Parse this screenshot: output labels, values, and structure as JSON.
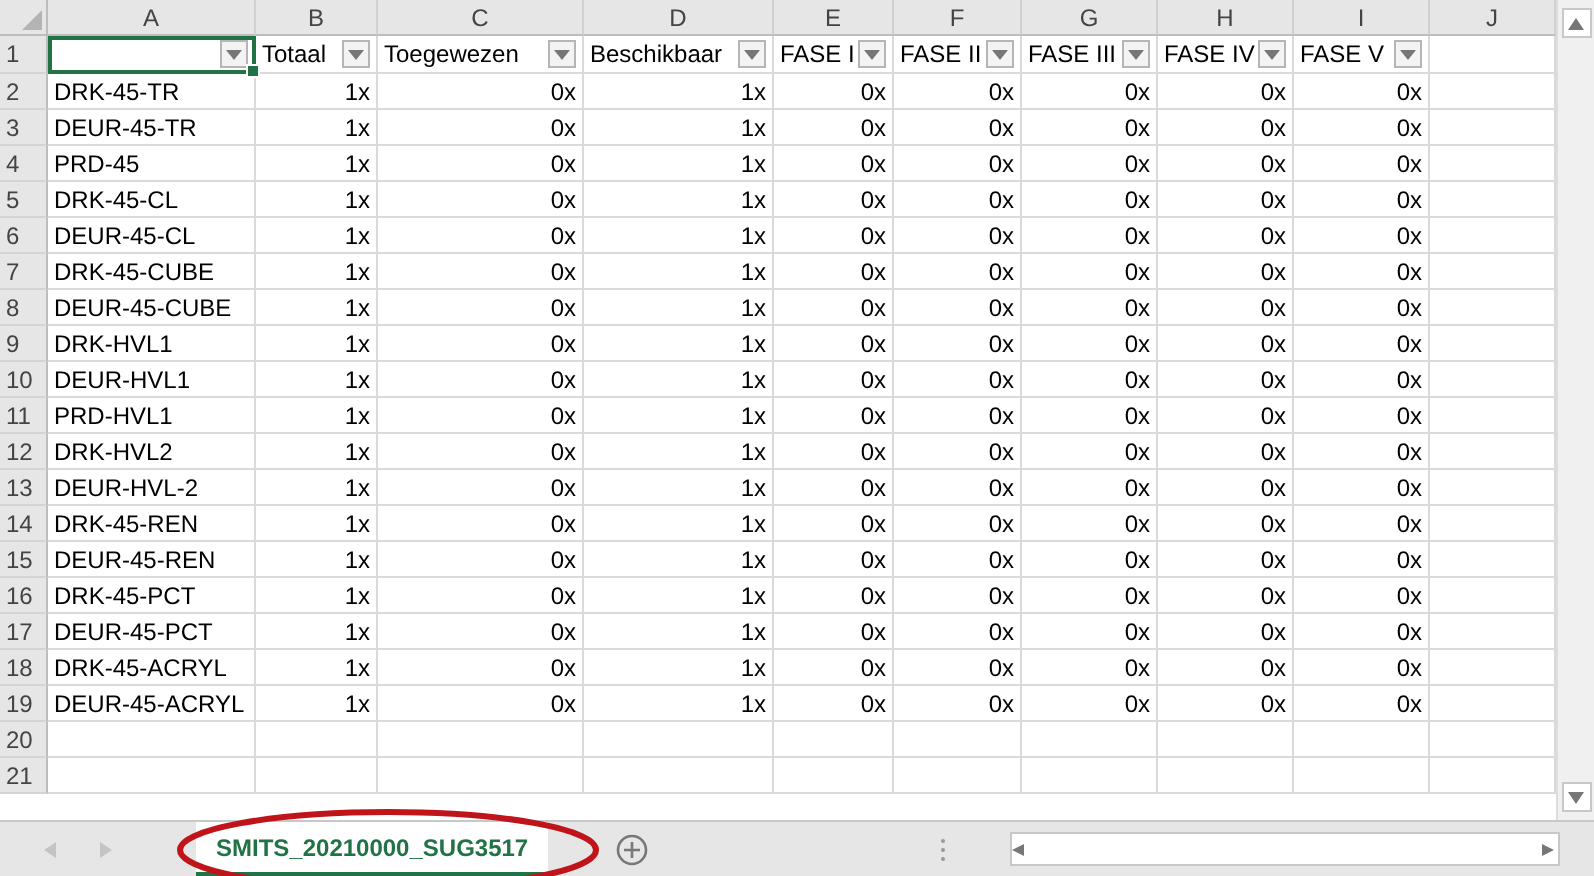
{
  "column_letters": [
    "A",
    "B",
    "C",
    "D",
    "E",
    "F",
    "G",
    "H",
    "I",
    "J"
  ],
  "header_row": {
    "num": "1",
    "cells": [
      {
        "filter": true,
        "selected": true
      },
      {
        "label": "Totaal",
        "filter": true,
        "selected": false
      },
      {
        "label": "Toegewezen",
        "filter": true,
        "selected": false
      },
      {
        "label": "Beschikbaar",
        "filter": true,
        "selected": false
      },
      {
        "label": "FASE I",
        "filter": true,
        "selected": false
      },
      {
        "label": "FASE II",
        "filter": true,
        "selected": false
      },
      {
        "label": "FASE III",
        "filter": true,
        "selected": false
      },
      {
        "label": "FASE IV",
        "filter": true,
        "selected": false
      },
      {
        "label": "FASE V",
        "filter": true,
        "selected": false
      }
    ]
  },
  "rows": [
    {
      "num": "2",
      "cells": [
        "DRK-45-TR",
        "1x",
        "0x",
        "1x",
        "0x",
        "0x",
        "0x",
        "0x",
        "0x"
      ]
    },
    {
      "num": "3",
      "cells": [
        "DEUR-45-TR",
        "1x",
        "0x",
        "1x",
        "0x",
        "0x",
        "0x",
        "0x",
        "0x"
      ]
    },
    {
      "num": "4",
      "cells": [
        "PRD-45",
        "1x",
        "0x",
        "1x",
        "0x",
        "0x",
        "0x",
        "0x",
        "0x"
      ]
    },
    {
      "num": "5",
      "cells": [
        "DRK-45-CL",
        "1x",
        "0x",
        "1x",
        "0x",
        "0x",
        "0x",
        "0x",
        "0x"
      ]
    },
    {
      "num": "6",
      "cells": [
        "DEUR-45-CL",
        "1x",
        "0x",
        "1x",
        "0x",
        "0x",
        "0x",
        "0x",
        "0x"
      ]
    },
    {
      "num": "7",
      "cells": [
        "DRK-45-CUBE",
        "1x",
        "0x",
        "1x",
        "0x",
        "0x",
        "0x",
        "0x",
        "0x"
      ]
    },
    {
      "num": "8",
      "cells": [
        "DEUR-45-CUBE",
        "1x",
        "0x",
        "1x",
        "0x",
        "0x",
        "0x",
        "0x",
        "0x"
      ]
    },
    {
      "num": "9",
      "cells": [
        "DRK-HVL1",
        "1x",
        "0x",
        "1x",
        "0x",
        "0x",
        "0x",
        "0x",
        "0x"
      ]
    },
    {
      "num": "10",
      "cells": [
        "DEUR-HVL1",
        "1x",
        "0x",
        "1x",
        "0x",
        "0x",
        "0x",
        "0x",
        "0x"
      ]
    },
    {
      "num": "11",
      "cells": [
        "PRD-HVL1",
        "1x",
        "0x",
        "1x",
        "0x",
        "0x",
        "0x",
        "0x",
        "0x"
      ]
    },
    {
      "num": "12",
      "cells": [
        "DRK-HVL2",
        "1x",
        "0x",
        "1x",
        "0x",
        "0x",
        "0x",
        "0x",
        "0x"
      ]
    },
    {
      "num": "13",
      "cells": [
        "DEUR-HVL-2",
        "1x",
        "0x",
        "1x",
        "0x",
        "0x",
        "0x",
        "0x",
        "0x"
      ]
    },
    {
      "num": "14",
      "cells": [
        "DRK-45-REN",
        "1x",
        "0x",
        "1x",
        "0x",
        "0x",
        "0x",
        "0x",
        "0x"
      ]
    },
    {
      "num": "15",
      "cells": [
        "DEUR-45-REN",
        "1x",
        "0x",
        "1x",
        "0x",
        "0x",
        "0x",
        "0x",
        "0x"
      ]
    },
    {
      "num": "16",
      "cells": [
        "DRK-45-PCT",
        "1x",
        "0x",
        "1x",
        "0x",
        "0x",
        "0x",
        "0x",
        "0x"
      ]
    },
    {
      "num": "17",
      "cells": [
        "DEUR-45-PCT",
        "1x",
        "0x",
        "1x",
        "0x",
        "0x",
        "0x",
        "0x",
        "0x"
      ]
    },
    {
      "num": "18",
      "cells": [
        "DRK-45-ACRYL",
        "1x",
        "0x",
        "1x",
        "0x",
        "0x",
        "0x",
        "0x",
        "0x"
      ]
    },
    {
      "num": "19",
      "cells": [
        "DEUR-45-ACRYL",
        "1x",
        "0x",
        "1x",
        "0x",
        "0x",
        "0x",
        "0x",
        "0x"
      ]
    },
    {
      "num": "20"
    },
    {
      "num": "21"
    }
  ],
  "sheet_tabs": [
    {
      "label": "SMITS_20210000_SUG3517",
      "selected": true
    }
  ]
}
